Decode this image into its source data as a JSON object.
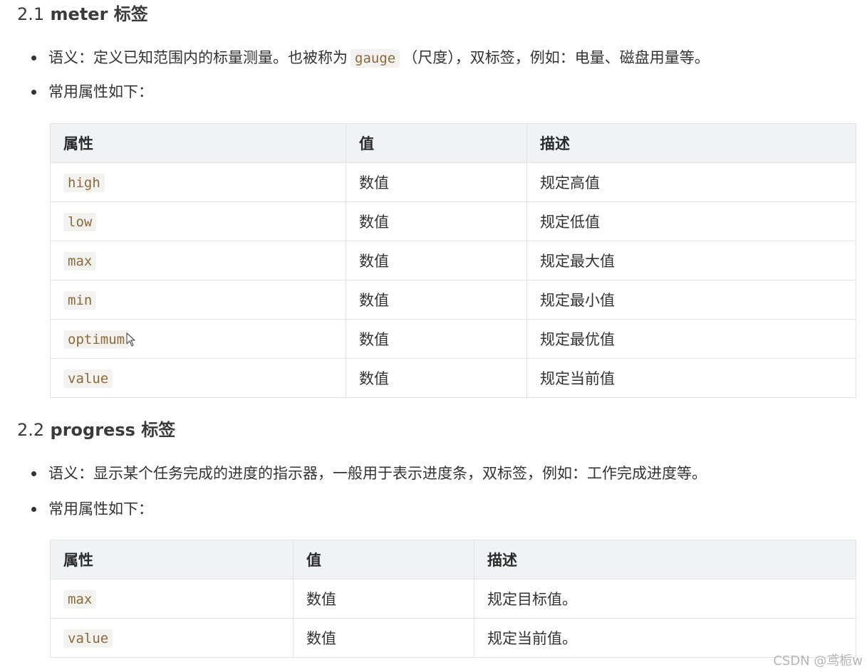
{
  "section1": {
    "number": "2.1",
    "title": "meter 标签",
    "bullet1_prefix": "语义：定义已知范围内的标量测量。也被称为",
    "bullet1_code": "gauge",
    "bullet1_suffix": "（尺度），双标签，例如：电量、磁盘用量等。",
    "bullet2": "常用属性如下：",
    "table": {
      "headers": [
        "属性",
        "值",
        "描述"
      ],
      "rows": [
        {
          "attr": "high",
          "value": "数值",
          "desc": "规定高值"
        },
        {
          "attr": "low",
          "value": "数值",
          "desc": "规定低值"
        },
        {
          "attr": "max",
          "value": "数值",
          "desc": "规定最大值"
        },
        {
          "attr": "min",
          "value": "数值",
          "desc": "规定最小值"
        },
        {
          "attr": "optimum",
          "value": "数值",
          "desc": "规定最优值"
        },
        {
          "attr": "value",
          "value": "数值",
          "desc": "规定当前值"
        }
      ]
    }
  },
  "section2": {
    "number": "2.2",
    "title": "progress 标签",
    "bullet1": "语义：显示某个任务完成的进度的指示器，一般用于表示进度条，双标签，例如：工作完成进度等。",
    "bullet2": "常用属性如下：",
    "table": {
      "headers": [
        "属性",
        "值",
        "描述"
      ],
      "rows": [
        {
          "attr": "max",
          "value": "数值",
          "desc": "规定目标值。"
        },
        {
          "attr": "value",
          "value": "数值",
          "desc": "规定当前值。"
        }
      ]
    }
  },
  "watermark": "CSDN @鸢栀w",
  "icons": {
    "cursor": "mouse-pointer-icon"
  },
  "colors": {
    "code_text": "#8a6a3c",
    "code_bg": "#f4f2ee",
    "header_bg": "#f1f2f4",
    "border": "#e3e3e3"
  }
}
